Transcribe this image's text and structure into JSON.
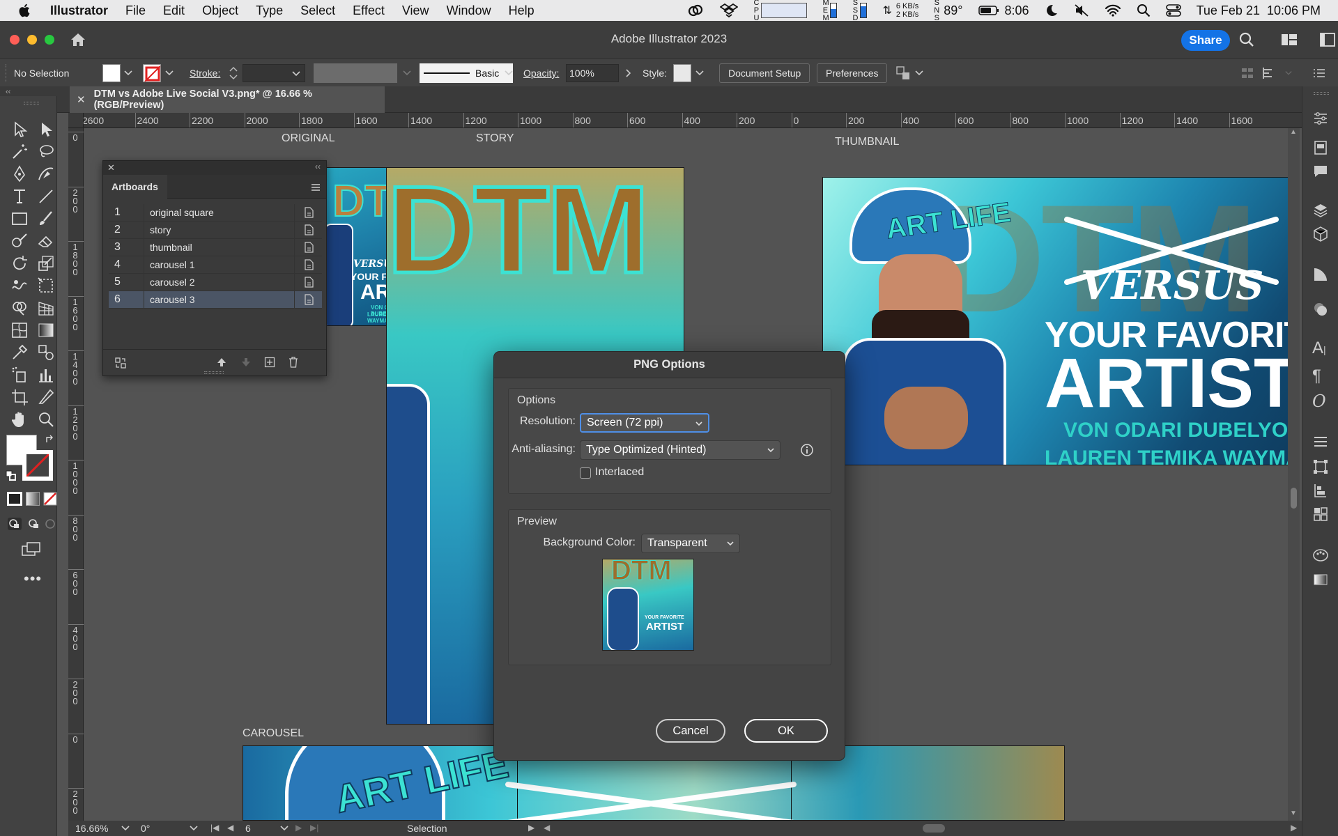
{
  "menubar": {
    "app": "Illustrator",
    "items": [
      "File",
      "Edit",
      "Object",
      "Type",
      "Select",
      "Effect",
      "View",
      "Window",
      "Help"
    ],
    "net_up": "6 KB/s",
    "net_down": "2 KB/s",
    "temperature": "89°",
    "battery_time": "8:06",
    "datetime": "Tue Feb 21  10:06 PM"
  },
  "titlebar": {
    "title": "Adobe Illustrator 2023",
    "share": "Share"
  },
  "control": {
    "selection": "No Selection",
    "stroke_label": "Stroke:",
    "brush_label": "Basic",
    "opacity_label": "Opacity:",
    "opacity_value": "100%",
    "style_label": "Style:",
    "document_setup": "Document Setup",
    "preferences": "Preferences"
  },
  "document": {
    "tab_title": "DTM vs Adobe Live Social V3.png* @ 16.66 % (RGB/Preview)"
  },
  "ruler": {
    "h_ticks": [
      "2600",
      "2400",
      "2200",
      "2000",
      "1800",
      "1600",
      "1400",
      "1200",
      "1000",
      "800",
      "600",
      "400",
      "200",
      "0",
      "200",
      "400",
      "600",
      "800",
      "1000",
      "1200",
      "1400",
      "1600"
    ],
    "v_ticks": [
      "0",
      "200",
      "1800",
      "1600",
      "1400",
      "1200",
      "1000",
      "800",
      "600",
      "400",
      "200",
      "0",
      "200"
    ]
  },
  "canvas": {
    "labels": {
      "original": "ORIGINAL",
      "story": "STORY",
      "thumbnail": "THUMBNAIL",
      "carousel": "CAROUSEL"
    },
    "art": {
      "logo": "DTM",
      "cap": "ART LIFE",
      "versus": "VERSUS",
      "line1": "YOUR FAVORITE",
      "line2": "ARTIST",
      "credit1": "VON ODARI DUBELYOO",
      "credit2": "LAUREN TEMIKA WAYMAN"
    }
  },
  "artboards_panel": {
    "title": "Artboards",
    "rows": [
      {
        "num": "1",
        "name": "original square"
      },
      {
        "num": "2",
        "name": "story"
      },
      {
        "num": "3",
        "name": "thumbnail"
      },
      {
        "num": "4",
        "name": "carousel 1"
      },
      {
        "num": "5",
        "name": "carousel 2"
      },
      {
        "num": "6",
        "name": "carousel 3"
      }
    ],
    "selected_index": 5
  },
  "dialog": {
    "title": "PNG Options",
    "options_label": "Options",
    "resolution_label": "Resolution:",
    "resolution_value": "Screen (72 ppi)",
    "antialias_label": "Anti-aliasing:",
    "antialias_value": "Type Optimized (Hinted)",
    "interlaced_label": "Interlaced",
    "interlaced_checked": false,
    "preview_label": "Preview",
    "bg_label": "Background Color:",
    "bg_value": "Transparent",
    "cancel": "Cancel",
    "ok": "OK"
  },
  "status": {
    "zoom": "16.66%",
    "rotation": "0°",
    "artboard_num": "6",
    "tool": "Selection"
  }
}
